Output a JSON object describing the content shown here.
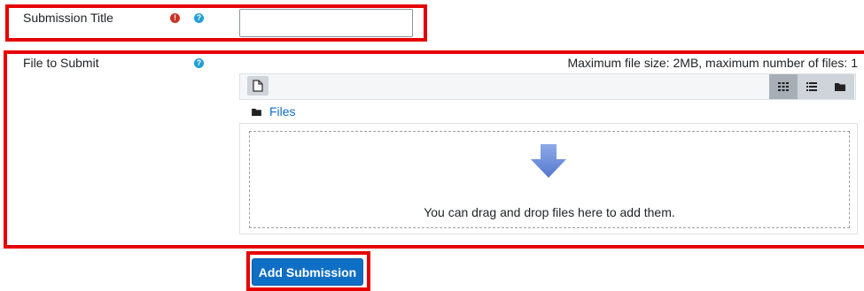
{
  "submission_title": {
    "label": "Submission Title",
    "required_icon": "exclamation-circle-icon",
    "help_icon": "question-circle-icon",
    "value": ""
  },
  "file_to_submit": {
    "label": "File to Submit",
    "help_icon": "question-circle-icon",
    "limits_text": "Maximum file size: 2MB, maximum number of files: 1",
    "toolbar": {
      "add_file_icon": "file-icon",
      "view_icons": [
        "grid-icon",
        "list-icon",
        "folder-icon"
      ]
    },
    "breadcrumb": {
      "folder_icon": "folder-icon",
      "label": "Files"
    },
    "drop_hint": "You can drag and drop files here to add them."
  },
  "actions": {
    "submit_label": "Add Submission"
  },
  "colors": {
    "highlight": "#e60000",
    "primary": "#0f6fc5",
    "link": "#0f6fc5",
    "required": "#ca3120",
    "help": "#1f9ed6",
    "arrow": "#6b8fdc"
  }
}
